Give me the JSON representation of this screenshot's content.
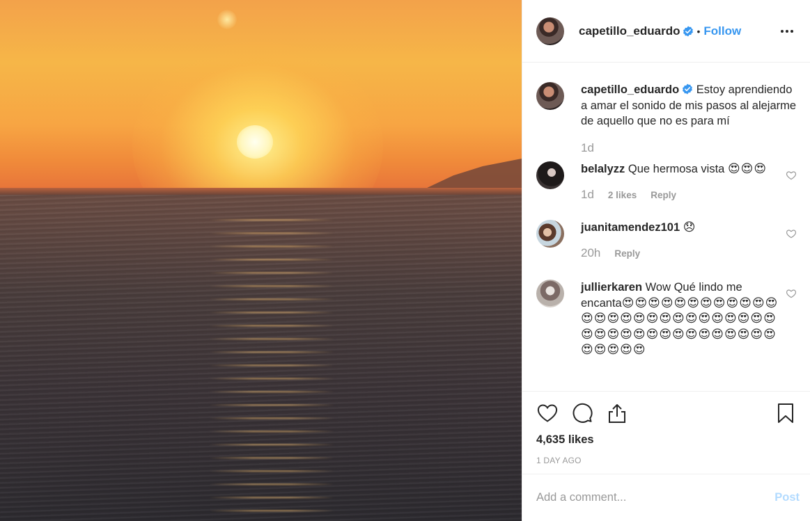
{
  "post": {
    "image_alt": "Sunset over the sea",
    "author": "capetillo_eduardo",
    "verified": true,
    "follow_separator": "•",
    "follow_label": "Follow"
  },
  "caption": {
    "username": "capetillo_eduardo",
    "text": "Estoy aprendiendo a amar el sonido de mis pasos al alejarme de aquello que no es para mí",
    "time": "1d"
  },
  "comments": [
    {
      "username": "belalyzz",
      "text": "Que hermosa vista",
      "emoji": "😍😍😍",
      "time": "1d",
      "likes": "2 likes",
      "reply": "Reply"
    },
    {
      "username": "juanitamendez101",
      "text": "",
      "emoji": "😞",
      "time": "20h",
      "reply": "Reply"
    },
    {
      "username": "jullierkaren",
      "text": "Wow Qué lindo me encanta",
      "emoji": "😍😍😍😍😍😍😍😍😍😍😍😍😍😍😍😍😍😍😍😍😍😍😍😍😍😍😍😍😍😍😍😍😍😍😍😍😍😍😍😍😍😍😍😍😍😍😍"
    }
  ],
  "actions": {
    "likes": "4,635 likes",
    "posted_ago": "1 DAY AGO"
  },
  "add_comment": {
    "placeholder": "Add a comment...",
    "post_label": "Post"
  },
  "icons": {
    "verified": "verified-badge-icon",
    "more": "more-options-icon",
    "like": "heart-icon",
    "comment": "comment-bubble-icon",
    "share": "share-icon",
    "save": "bookmark-icon"
  },
  "colors": {
    "accent": "#3897f0",
    "post_disabled": "#b3dbff",
    "muted": "#999999",
    "text": "#262626"
  }
}
